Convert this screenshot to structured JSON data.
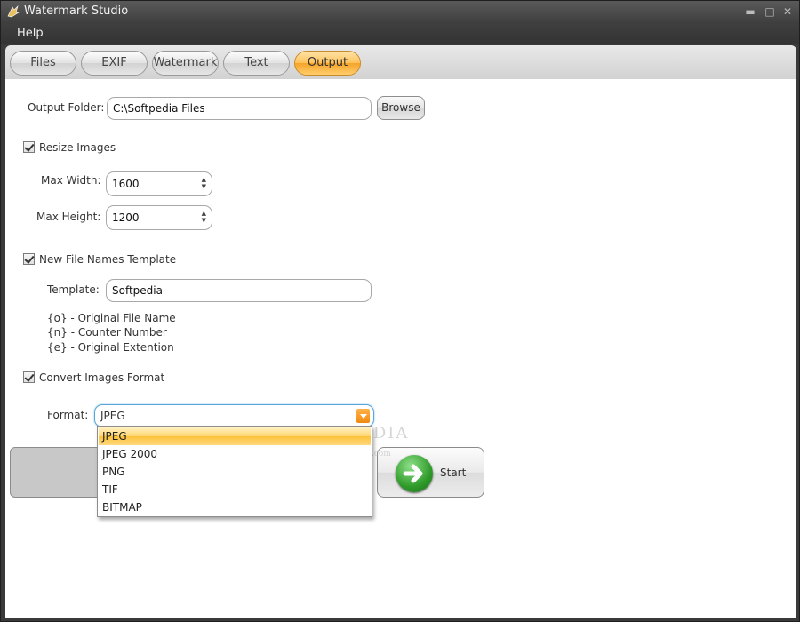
{
  "window": {
    "title": "Watermark Studio",
    "minimize": "▬",
    "maximize": "□",
    "close": "✕"
  },
  "menu": {
    "help": "Help"
  },
  "tabs": [
    {
      "label": "Files",
      "active": false
    },
    {
      "label": "EXIF",
      "active": false
    },
    {
      "label": "Watermark",
      "active": false
    },
    {
      "label": "Text",
      "active": false
    },
    {
      "label": "Output",
      "active": true
    }
  ],
  "output_folder": {
    "label": "Output Folder:",
    "value": "C:\\Softpedia Files",
    "browse_label": "Browse"
  },
  "resize": {
    "checkbox_label": "Resize Images",
    "checked": true,
    "max_width_label": "Max Width:",
    "max_width_value": "1600",
    "max_height_label": "Max Height:",
    "max_height_value": "1200"
  },
  "file_names": {
    "checkbox_label": "New File Names Template",
    "checked": true,
    "template_label": "Template:",
    "template_value": "Softpedia",
    "hints": [
      "{o} - Original File Name",
      "{n} - Counter Number",
      "{e} - Original Extention"
    ]
  },
  "convert": {
    "checkbox_label": "Convert Images Format",
    "checked": true,
    "format_label": "Format:",
    "format_value": "JPEG",
    "options": [
      "JPEG",
      "JPEG 2000",
      "PNG",
      "TIF",
      "BITMAP"
    ],
    "highlighted_option": "JPEG"
  },
  "start": {
    "label": "Start"
  },
  "overlay": {
    "brand": "SOFTPEDIA",
    "url": "www.softpedia.com"
  },
  "colors": {
    "accent_orange": "#f6a428",
    "start_green": "#2f9b2a",
    "focus_blue": "#5aa6d8"
  }
}
